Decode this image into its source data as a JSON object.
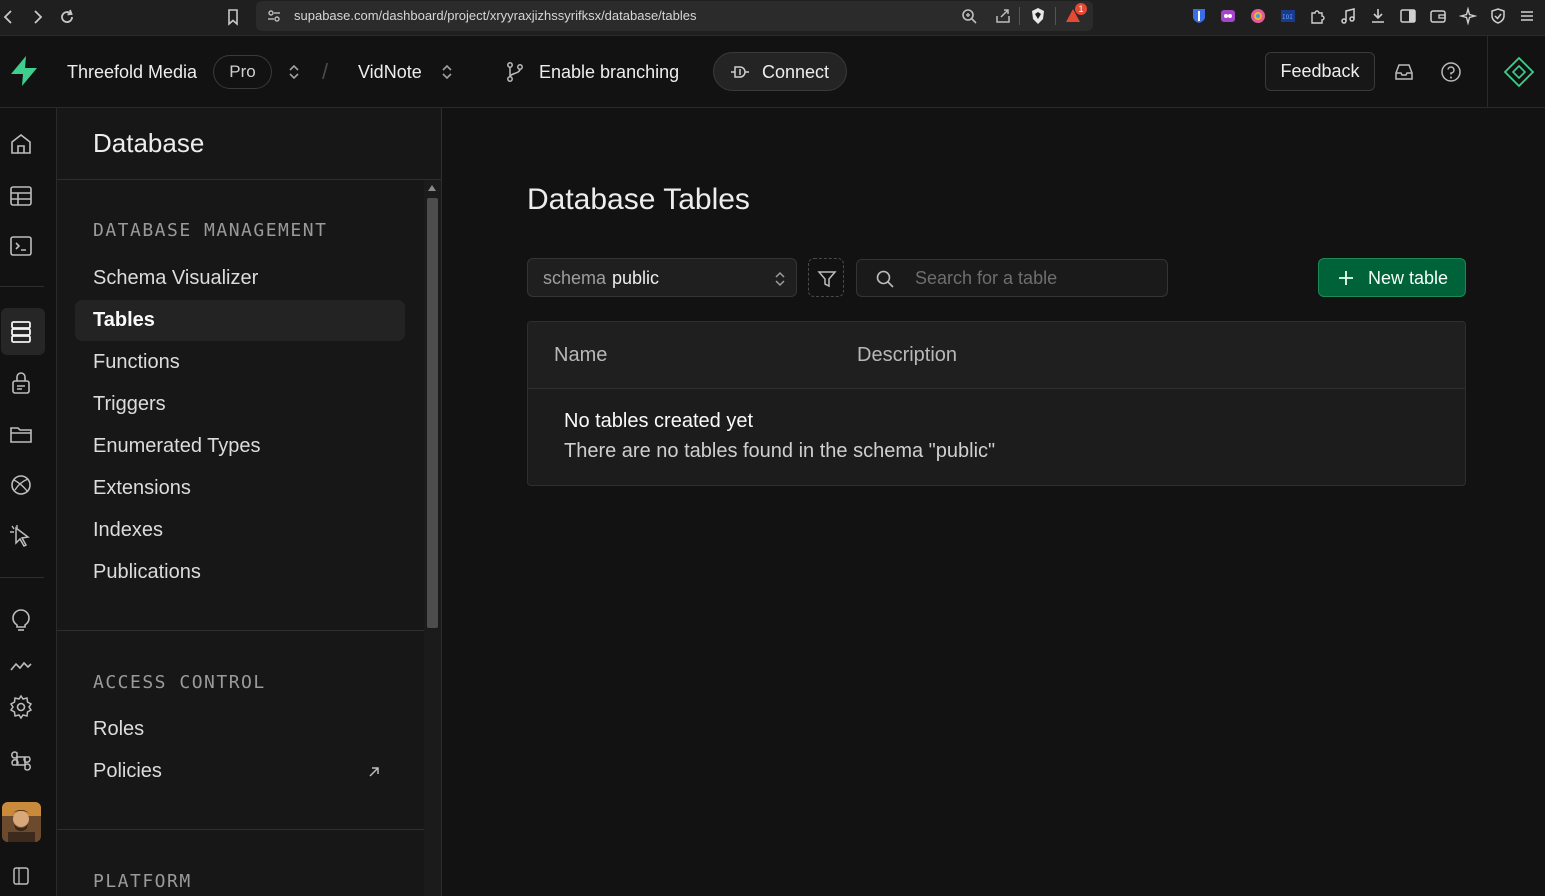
{
  "browser": {
    "url": "supabase.com/dashboard/project/xryyraxjizhssyrifksx/database/tables",
    "notification_count": "1"
  },
  "header": {
    "org_name": "Threefold Media",
    "plan": "Pro",
    "project_name": "VidNote",
    "branching_label": "Enable branching",
    "connect_label": "Connect",
    "feedback_label": "Feedback"
  },
  "rail": {
    "items": [
      "home-icon",
      "table-editor-icon",
      "sql-editor-icon",
      "database-icon",
      "auth-icon",
      "storage-icon",
      "realtime-icon",
      "edge-functions-icon",
      "advisors-icon",
      "reports-icon",
      "settings-icon",
      "command-icon",
      "sidebar-toggle-icon"
    ],
    "active": "database-icon"
  },
  "sidebar": {
    "title": "Database",
    "sections": [
      {
        "label": "DATABASE MANAGEMENT",
        "items": [
          {
            "label": "Schema Visualizer"
          },
          {
            "label": "Tables",
            "active": true
          },
          {
            "label": "Functions"
          },
          {
            "label": "Triggers"
          },
          {
            "label": "Enumerated Types"
          },
          {
            "label": "Extensions"
          },
          {
            "label": "Indexes"
          },
          {
            "label": "Publications"
          }
        ]
      },
      {
        "label": "ACCESS CONTROL",
        "items": [
          {
            "label": "Roles"
          },
          {
            "label": "Policies",
            "external": true
          }
        ]
      },
      {
        "label": "PLATFORM",
        "items": []
      }
    ]
  },
  "main": {
    "title": "Database Tables",
    "schema_key": "schema",
    "schema_value": "public",
    "search_placeholder": "Search for a table",
    "new_table_label": "New table",
    "columns": [
      "Name",
      "Description"
    ],
    "empty_title": "No tables created yet",
    "empty_description": "There are no tables found in the schema \"public\""
  },
  "colors": {
    "brand": "#3ecf8e",
    "primary_button": "#006239",
    "background": "#121212"
  }
}
